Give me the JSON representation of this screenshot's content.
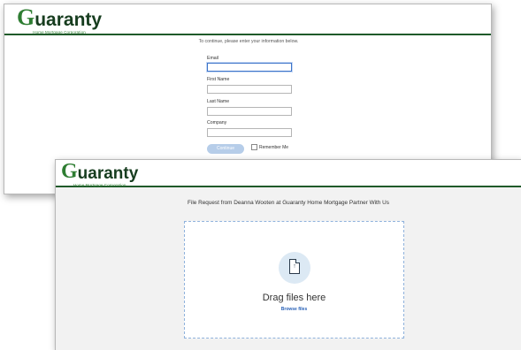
{
  "brand": {
    "logo_first": "G",
    "logo_rest": "uaranty",
    "tagline": "Home Mortgage Corporation"
  },
  "login_form": {
    "instructions": "To continue, please enter your information below.",
    "fields": [
      {
        "label": "Email",
        "value": ""
      },
      {
        "label": "First Name",
        "value": ""
      },
      {
        "label": "Last Name",
        "value": ""
      },
      {
        "label": "Company",
        "value": ""
      }
    ],
    "continue_label": "Continue",
    "remember_label": "Remember Me"
  },
  "file_request": {
    "title": "File Request from Deanna Wooten at Guaranty Home Mortgage Partner With Us",
    "drag_text": "Drag files here",
    "browse_label": "Browse files"
  },
  "colors": {
    "brand_green": "#2e7d32",
    "header_rule": "#1f5a2a",
    "button_disabled": "#b6cde9",
    "link_blue": "#2a62b8"
  }
}
